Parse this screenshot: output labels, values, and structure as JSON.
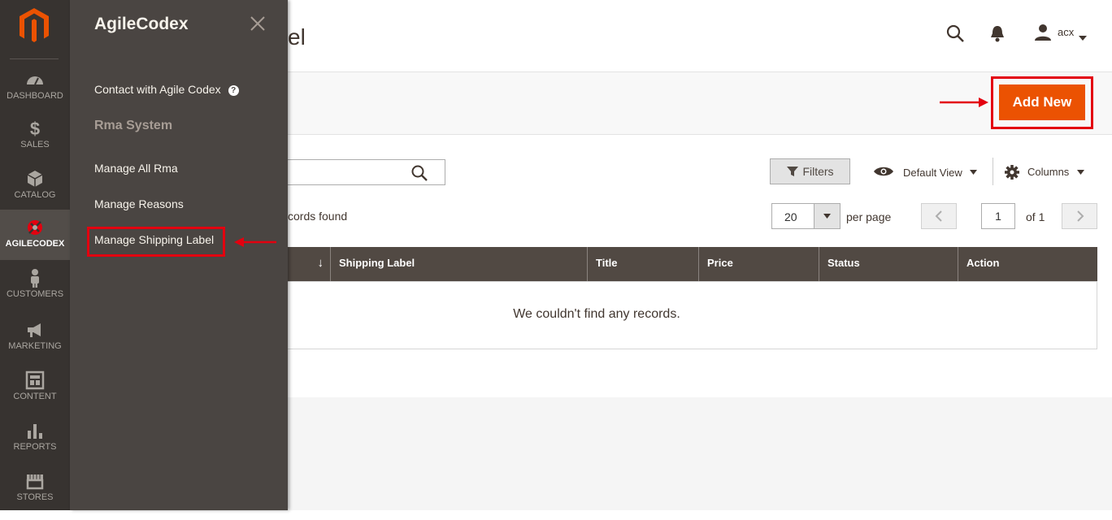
{
  "nav": {
    "items": [
      {
        "label": "DASHBOARD",
        "icon": "dashboard-icon"
      },
      {
        "label": "SALES",
        "icon": "dollar-icon"
      },
      {
        "label": "CATALOG",
        "icon": "cube-icon"
      },
      {
        "label": "AGILECODEX",
        "icon": "agilecodex-icon"
      },
      {
        "label": "CUSTOMERS",
        "icon": "person-icon"
      },
      {
        "label": "MARKETING",
        "icon": "megaphone-icon"
      },
      {
        "label": "CONTENT",
        "icon": "layout-icon"
      },
      {
        "label": "REPORTS",
        "icon": "bar-chart-icon"
      },
      {
        "label": "STORES",
        "icon": "store-icon"
      }
    ],
    "active": "AGILECODEX"
  },
  "flyout": {
    "title": "AgileCodex",
    "contact_link": "Contact with Agile Codex",
    "help_glyph": "?",
    "group_title": "Rma System",
    "links": [
      "Manage All Rma",
      "Manage Reasons",
      "Manage Shipping Label"
    ]
  },
  "header": {
    "title_visible": "el",
    "user": "acx"
  },
  "actions": {
    "add_new": "Add New"
  },
  "toolbar": {
    "filters": "Filters",
    "view": "Default View",
    "columns": "Columns",
    "records_found": "cords found",
    "per_page_value": "20",
    "per_page_label": "per page",
    "page_current": "1",
    "page_of": "of 1"
  },
  "grid": {
    "sort_glyph": "↓",
    "columns": [
      "Shipping Label",
      "Title",
      "Price",
      "Status",
      "Action"
    ],
    "empty_message": "We couldn't find any records."
  },
  "colors": {
    "accent": "#eb5202",
    "highlight": "#e3000f",
    "nav_bg": "#373330",
    "flyout_bg": "#4a4542",
    "grid_header": "#514943"
  }
}
